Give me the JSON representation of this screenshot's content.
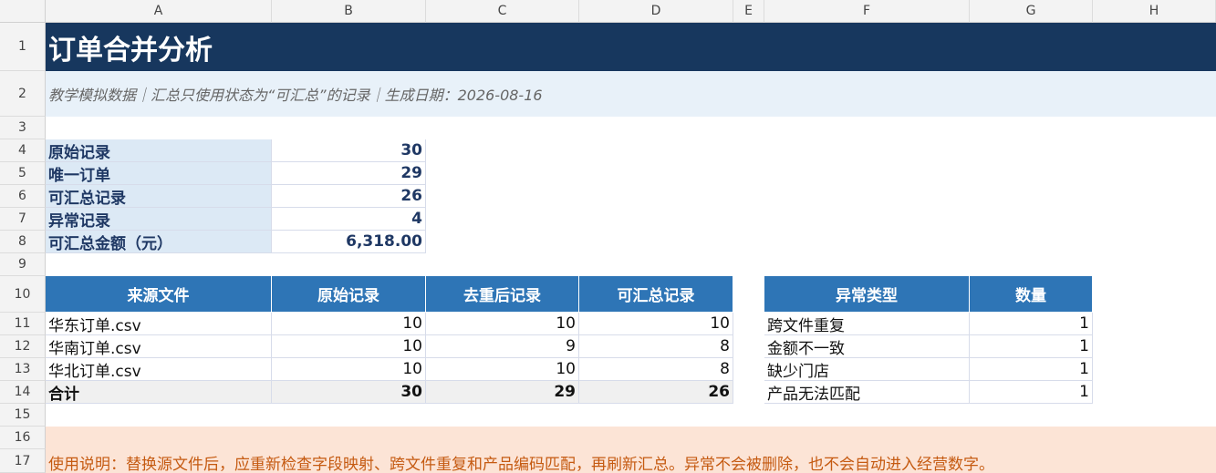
{
  "columns": [
    "A",
    "B",
    "C",
    "D",
    "E",
    "F",
    "G",
    "H"
  ],
  "rows": [
    "1",
    "2",
    "3",
    "4",
    "5",
    "6",
    "7",
    "8",
    "9",
    "10",
    "11",
    "12",
    "13",
    "14",
    "15",
    "16",
    "17"
  ],
  "title": "订单合并分析",
  "subtitle": "教学模拟数据｜汇总只使用状态为“可汇总”的记录｜生成日期：2026-08-16",
  "summary": [
    {
      "label": "原始记录",
      "value": "30"
    },
    {
      "label": "唯一订单",
      "value": "29"
    },
    {
      "label": "可汇总记录",
      "value": "26"
    },
    {
      "label": "异常记录",
      "value": "4"
    },
    {
      "label": "可汇总金额（元）",
      "value": "6,318.00"
    }
  ],
  "source_table": {
    "headers": [
      "来源文件",
      "原始记录",
      "去重后记录",
      "可汇总记录"
    ],
    "rows": [
      [
        "华东订单.csv",
        "10",
        "10",
        "10"
      ],
      [
        "华南订单.csv",
        "10",
        "9",
        "8"
      ],
      [
        "华北订单.csv",
        "10",
        "10",
        "8"
      ]
    ],
    "total": [
      "合计",
      "30",
      "29",
      "26"
    ]
  },
  "exception_table": {
    "headers": [
      "异常类型",
      "数量"
    ],
    "rows": [
      [
        "跨文件重复",
        "1"
      ],
      [
        "金额不一致",
        "1"
      ],
      [
        "缺少门店",
        "1"
      ],
      [
        "产品无法匹配",
        "1"
      ]
    ]
  },
  "note": "使用说明：替换源文件后，应重新检查字段映射、跨文件重复和产品编码匹配，再刷新汇总。异常不会被删除，也不会自动进入经营数字。"
}
